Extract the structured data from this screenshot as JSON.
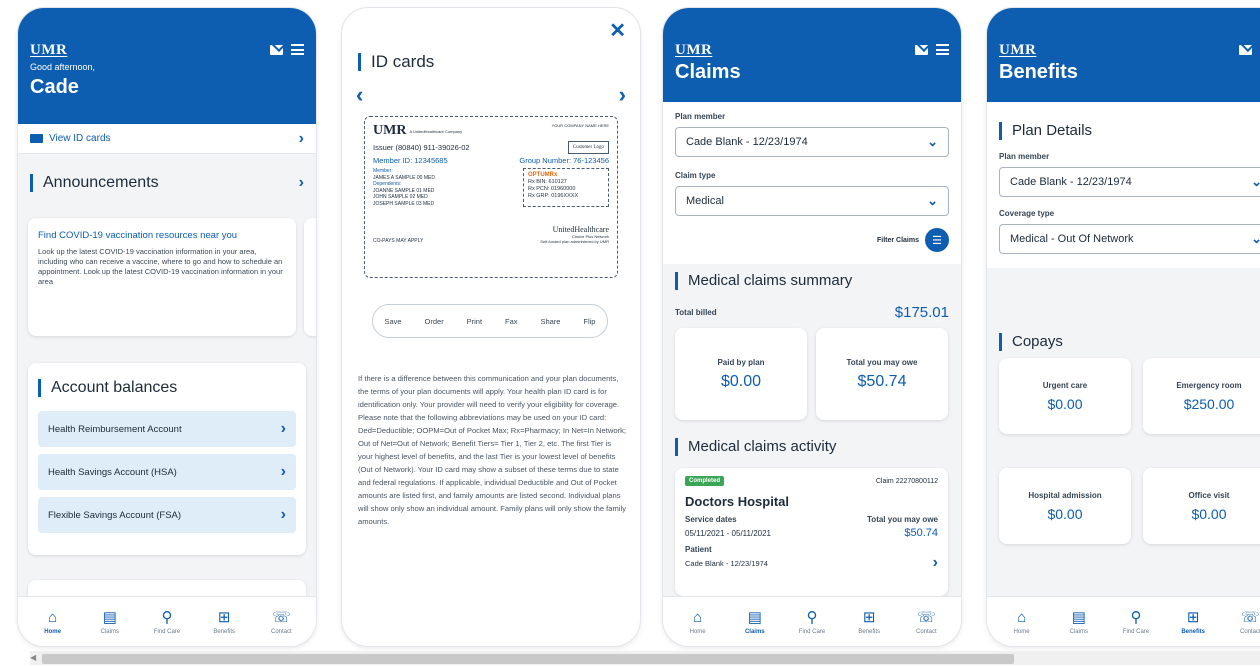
{
  "brand": {
    "logo": "UMR",
    "header_color": "#0d5db0"
  },
  "screen1": {
    "greeting": "Good afternoon,",
    "name": "Cade",
    "view_id_cards": "View ID cards",
    "announcements_title": "Announcements",
    "announcement": {
      "title": "Find COVID-19 vaccination resources near you",
      "body": "Look up the latest COVID-19 vaccination information in your area, including who can receive a vaccine, where to go and how to schedule an appointment. Look up the latest COVID-19 vaccination information in your area"
    },
    "balances_title": "Account balances",
    "accounts": [
      {
        "label": "Health Reimbursement Account"
      },
      {
        "label": "Health Savings Account (HSA)"
      },
      {
        "label": "Flexible Savings Account (FSA)"
      }
    ]
  },
  "screen2": {
    "title": "ID cards",
    "card": {
      "logo": "UMR",
      "tagline": "A UnitedHealthcare Company",
      "company_name": "YOUR COMPANY NAME HERE",
      "issuer": "Issuer (80840) 911-39026-02",
      "customer_logo": "Customer Logo",
      "member_id": "Member ID: 12345685",
      "group_number": "Group Number: 76-123456",
      "member_label": "Member:",
      "member_name": "JAMES A SAMPLE 00 MED",
      "dependents_label": "Dependents:",
      "dependents": [
        "JOANNE SAMPLE 01 MED",
        "JOHN SAMPLE 02 MED",
        "JOSEPH SAMPLE 03 MED"
      ],
      "optum": "OPTUMRx",
      "rx_bin": "Rx BIN: 610127",
      "rx_pcn": "Rx PCN: 01960000",
      "rx_grp": "Rx GRP: 0196XXXX",
      "copays": "CO-PAYS MAY APPLY",
      "uhc": "UnitedHealthcare",
      "uhc_sub": "Choice Plus Network",
      "self_funded": "Self-funded plan administered by UMR"
    },
    "actions": [
      "Save",
      "Order",
      "Print",
      "Fax",
      "Share",
      "Flip"
    ],
    "disclaimer": "If there is a difference between this communication and your plan documents, the terms of your plan documents will apply. Your health plan ID card is for identification only. Your provider will need to verify your eligibility for coverage. Please note that the following abbreviations may be used on your ID card: Ded=Deductible; OOPM=Out of Pocket Max; Rx=Pharmacy; In Net=In Network; Out of Net=Out of Network; Benefit Tiers= Tier 1, Tier 2, etc. The first Tier is your highest level of benefits, and the last Tier is your lowest level of benefits (Out of Network). Your ID card may show a subset of these terms due to state and federal regulations. If applicable, individual Deductible and Out of Pocket amounts are listed first, and family amounts are listed second. Individual plans will show only show an individual amount. Family plans will only show the family amounts."
  },
  "screen3": {
    "title": "Claims",
    "plan_member_label": "Plan member",
    "plan_member_value": "Cade Blank - 12/23/1974",
    "claim_type_label": "Claim type",
    "claim_type_value": "Medical",
    "filter_label": "Filter Claims",
    "summary_title": "Medical claims summary",
    "total_billed_label": "Total billed",
    "total_billed_value": "$175.01",
    "paid_by_plan_label": "Paid by plan",
    "paid_by_plan_value": "$0.00",
    "you_owe_label": "Total you may owe",
    "you_owe_value": "$50.74",
    "activity_title": "Medical claims activity",
    "claim": {
      "status": "Completed",
      "claim_number": "Claim  22270800112",
      "provider": "Doctors Hospital",
      "service_dates_label": "Service dates",
      "service_dates_value": "05/11/2021 - 05/11/2021",
      "owe_label": "Total you may owe",
      "owe_value": "$50.74",
      "patient_label": "Patient",
      "patient_value": "Cade Blank - 12/23/1974"
    }
  },
  "screen4": {
    "title": "Benefits",
    "plan_details_title": "Plan Details",
    "plan_member_label": "Plan member",
    "plan_member_value": "Cade Blank - 12/23/1974",
    "coverage_label": "Coverage type",
    "coverage_value": "Medical - Out Of Network",
    "copays_title": "Copays",
    "copays": [
      {
        "label": "Urgent care",
        "value": "$0.00"
      },
      {
        "label": "Emergency room",
        "value": "$250.00"
      },
      {
        "label": "Hospital admission",
        "value": "$0.00"
      },
      {
        "label": "Office visit",
        "value": "$0.00"
      }
    ]
  },
  "tabs": [
    {
      "label": "Home",
      "icon": "home-icon"
    },
    {
      "label": "Claims",
      "icon": "claims-icon"
    },
    {
      "label": "Find Care",
      "icon": "search-icon"
    },
    {
      "label": "Benefits",
      "icon": "benefits-icon"
    },
    {
      "label": "Contact",
      "icon": "contact-icon"
    }
  ]
}
